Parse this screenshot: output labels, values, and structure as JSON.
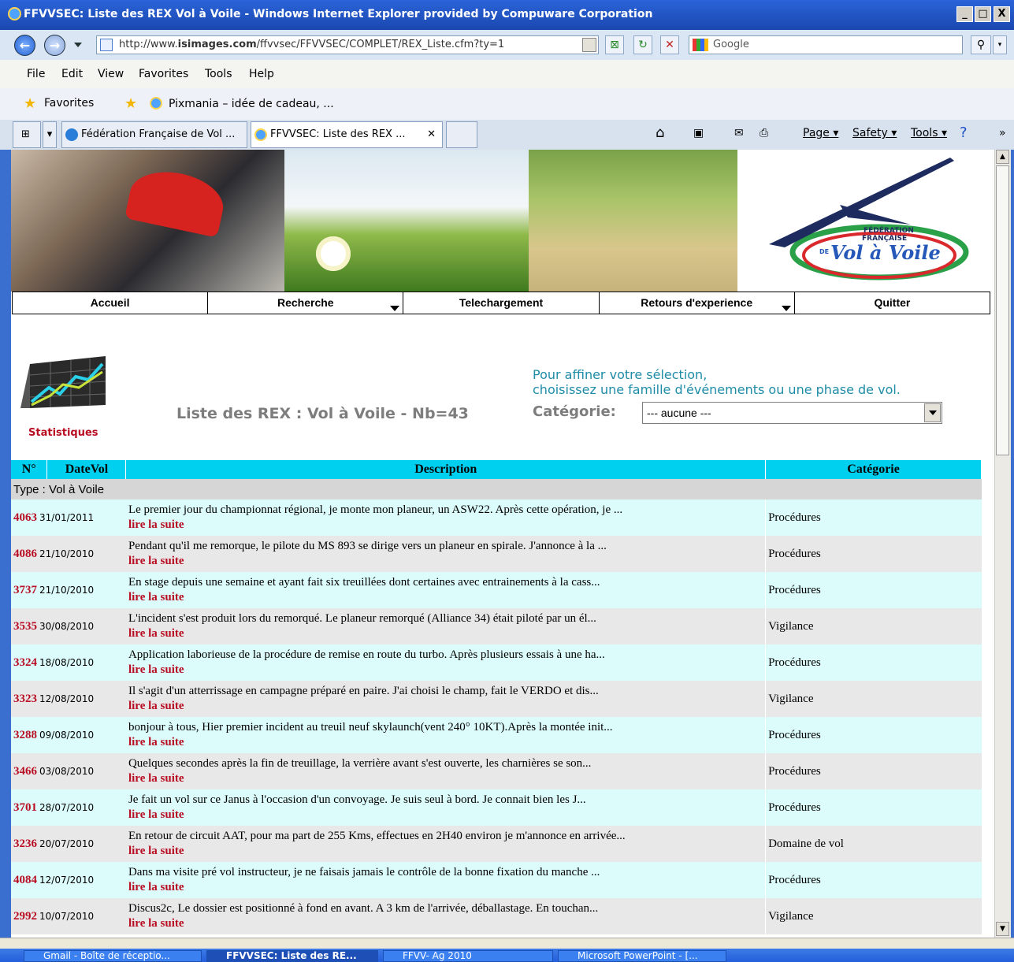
{
  "window": {
    "title": "FFVVSEC: Liste des REX Vol à Voile - Windows Internet Explorer provided by Compuware Corporation",
    "min": "_",
    "max": "□",
    "close": "X"
  },
  "address": {
    "url_prefix": "http://www.",
    "url_domain": "isimages.com",
    "url_rest": "/ffvvsec/FFVVSEC/COMPLET/REX_Liste.cfm?ty=1",
    "search_placeholder": "Google"
  },
  "menu": [
    "File",
    "Edit",
    "View",
    "Favorites",
    "Tools",
    "Help"
  ],
  "favorites": {
    "label": "Favorites",
    "link": "Pixmania – idée de cadeau, ..."
  },
  "tabs": [
    {
      "label": "Fédération Française de Vol ..."
    },
    {
      "label": "FFVVSEC: Liste des REX ...",
      "close": "✕"
    }
  ],
  "commands": {
    "page": "Page ▾",
    "safety": "Safety ▾",
    "tools": "Tools ▾"
  },
  "logo": {
    "line1": "FÉDÉRATION",
    "line2": "FRANÇAISE",
    "brand": "Vol à Voile",
    "prefix": "DE"
  },
  "nav": [
    "Accueil",
    "Recherche",
    "Telechargement",
    "Retours d'experience",
    "Quitter"
  ],
  "stats_label": "Statistiques",
  "list_title": "Liste des REX : Vol à Voile - Nb=43",
  "refine": {
    "line1": "Pour affiner votre sélection,",
    "line2": "choisissez une famille d'événements ou une phase de vol."
  },
  "category": {
    "label": "Catégorie:",
    "selected": "--- aucune ---"
  },
  "table": {
    "headers": [
      "N°",
      "DateVol",
      "Description",
      "Catégorie"
    ],
    "type_row": "Type : Vol à Voile",
    "more": "lire la suite",
    "rows": [
      {
        "n": "4063",
        "date": "31/01/2011",
        "desc": "Le premier jour du championnat régional, je monte mon planeur, un ASW22. Après cette opération, je ...",
        "cat": "Procédures"
      },
      {
        "n": "4086",
        "date": "21/10/2010",
        "desc": "Pendant qu'il me remorque, le pilote du MS 893 se dirige vers un planeur en spirale. J'annonce à la ...",
        "cat": "Procédures"
      },
      {
        "n": "3737",
        "date": "21/10/2010",
        "desc": "En stage depuis une semaine et ayant fait six treuillées dont certaines avec entrainements à la cass...",
        "cat": "Procédures"
      },
      {
        "n": "3535",
        "date": "30/08/2010",
        "desc": "L'incident s'est produit lors du remorqué. Le planeur remorqué (Alliance 34) était piloté par un él...",
        "cat": "Vigilance"
      },
      {
        "n": "3324",
        "date": "18/08/2010",
        "desc": "Application laborieuse de la procédure de remise en route du turbo. Après plusieurs essais à une ha...",
        "cat": "Procédures"
      },
      {
        "n": "3323",
        "date": "12/08/2010",
        "desc": "Il s'agit d'un atterrissage en campagne préparé en paire. J'ai choisi le champ, fait le VERDO et dis...",
        "cat": "Vigilance"
      },
      {
        "n": "3288",
        "date": "09/08/2010",
        "desc": "bonjour à tous, Hier premier incident au treuil neuf skylaunch(vent 240° 10KT).Après la montée init...",
        "cat": "Procédures"
      },
      {
        "n": "3466",
        "date": "03/08/2010",
        "desc": "Quelques secondes après la fin de treuillage, la verrière avant s'est ouverte, les charnières se son...",
        "cat": "Procédures"
      },
      {
        "n": "3701",
        "date": "28/07/2010",
        "desc": "Je fait un vol sur ce Janus à l'occasion d'un convoyage. Je suis seul à bord. Je connait bien les J...",
        "cat": "Procédures"
      },
      {
        "n": "3236",
        "date": "20/07/2010",
        "desc": "En retour de circuit AAT, pour ma part de 255 Kms, effectues en 2H40 environ je m'annonce en arrivée...",
        "cat": "Domaine de vol"
      },
      {
        "n": "4084",
        "date": "12/07/2010",
        "desc": "Dans ma visite pré vol instructeur, je ne faisais jamais le contrôle de la bonne fixation du manche ...",
        "cat": "Procédures"
      },
      {
        "n": "2992",
        "date": "10/07/2010",
        "desc": "Discus2c, Le dossier est positionné à fond en avant. A 3 km de l'arrivée, déballastage. En touchan...",
        "cat": "Vigilance"
      }
    ]
  },
  "taskbar": [
    {
      "label": "Gmail - Boîte de réceptio..."
    },
    {
      "label": "FFVVSEC: Liste des RE..."
    },
    {
      "label": "FFVV- Ag 2010"
    },
    {
      "label": "Microsoft PowerPoint - [..."
    }
  ],
  "colors": {
    "accent_red": "#b80d22",
    "header_cyan": "#00d0f0",
    "row_cyan": "#dcfcfc",
    "row_grey": "#e8e8e8",
    "teal_text": "#1f8ca7"
  }
}
